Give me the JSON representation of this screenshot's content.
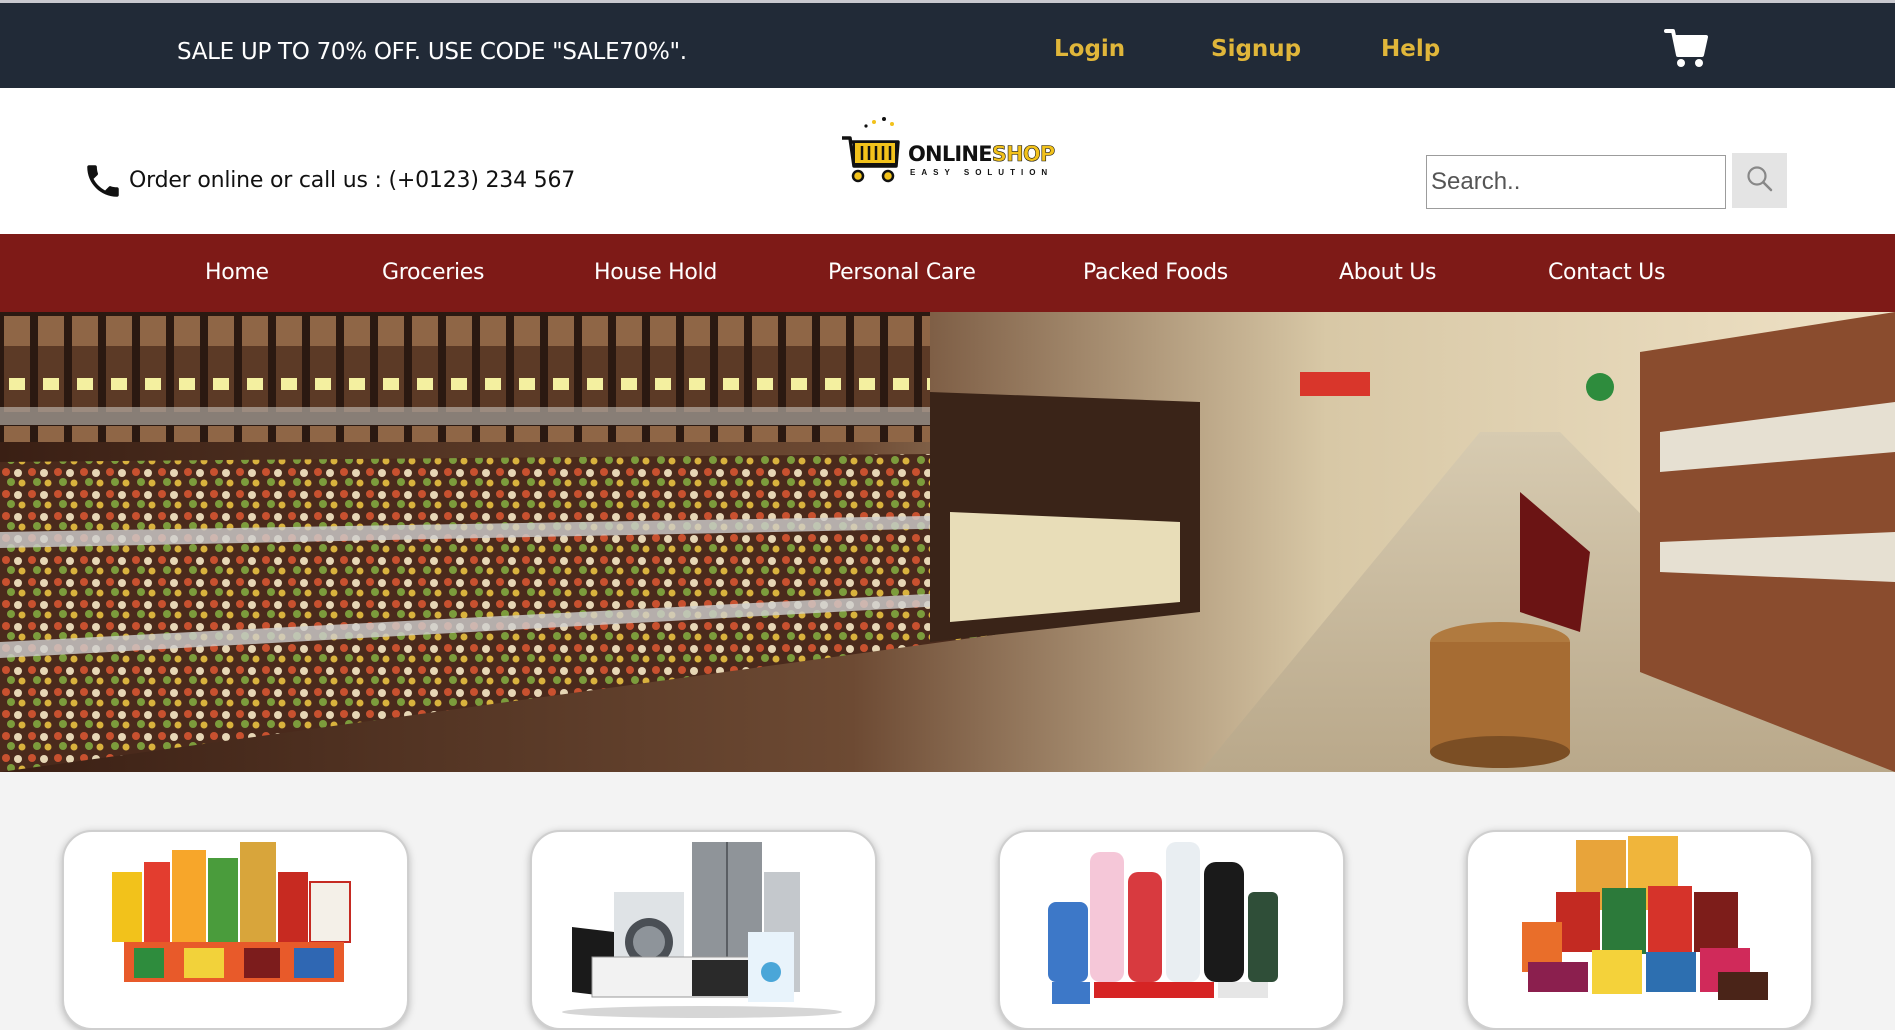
{
  "topbar": {
    "promo": "SALE UP TO 70% OFF. USE CODE \"SALE70%\".",
    "links": [
      "Login",
      "Signup",
      "Help"
    ],
    "cart_icon": "shopping-cart-icon"
  },
  "header": {
    "phone_icon": "phone-icon",
    "contact_text": "Order online or call us : (+0123) 234 567",
    "logo": {
      "word1": "ONLINE",
      "word2": "SHOP",
      "tagline": "EASY SOLUTION"
    },
    "search": {
      "placeholder": "Search..",
      "icon": "search-icon"
    }
  },
  "nav": {
    "items": [
      "Home",
      "Groceries",
      "House Hold",
      "Personal Care",
      "Packed Foods",
      "About Us",
      "Contact Us"
    ]
  },
  "categories": [
    {
      "name": "groceries-products"
    },
    {
      "name": "household-appliances"
    },
    {
      "name": "personal-care-products"
    },
    {
      "name": "packed-foods"
    }
  ],
  "colors": {
    "topbar_bg": "#212a37",
    "link_accent": "#e0b63a",
    "nav_bg": "#7e1a17",
    "logo_yellow": "#f2c21b"
  }
}
